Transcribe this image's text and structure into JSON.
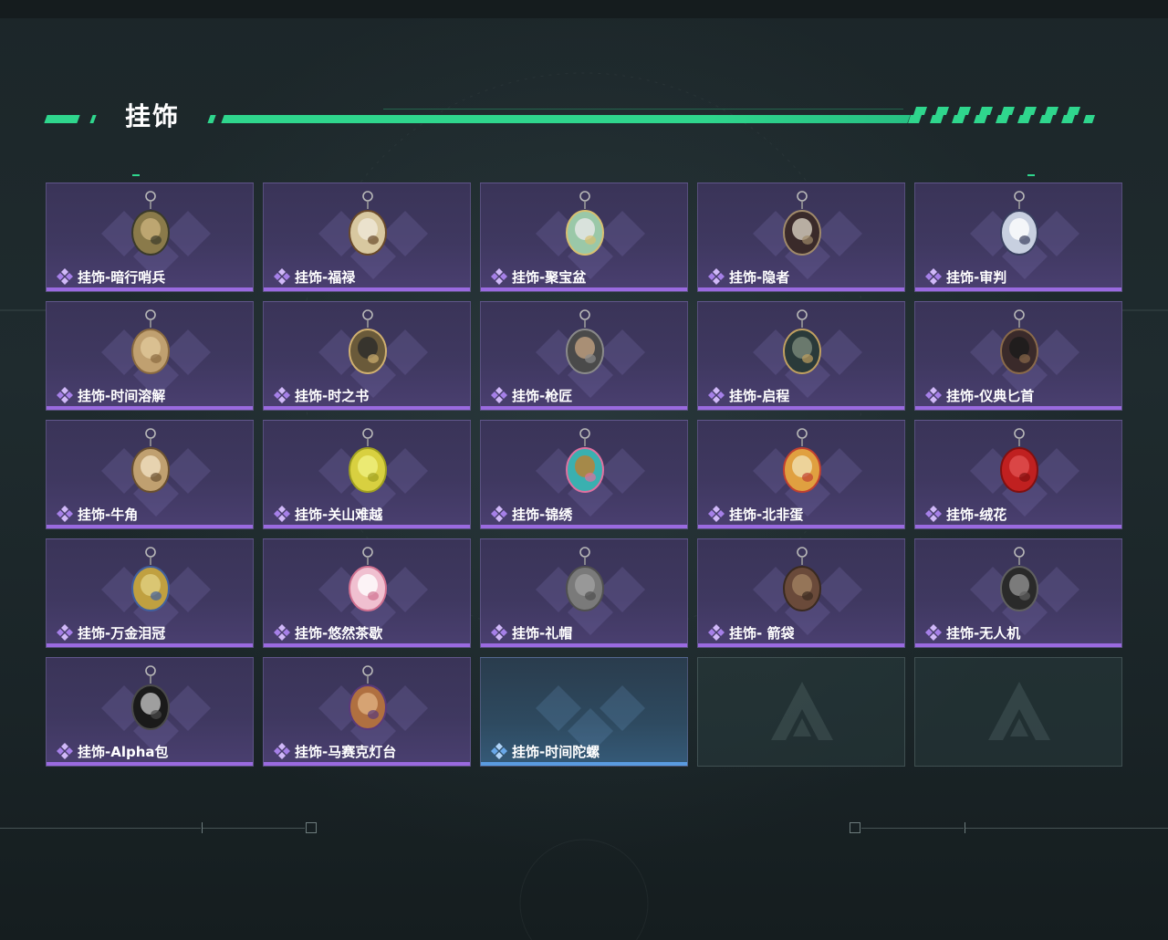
{
  "header": {
    "title": "挂饰"
  },
  "items": [
    {
      "label": "挂饰-暗行哨兵",
      "icon": "sentinel-charm-icon",
      "rarity": "purple"
    },
    {
      "label": "挂饰-福禄",
      "icon": "gourd-charm-icon",
      "rarity": "purple"
    },
    {
      "label": "挂饰-聚宝盆",
      "icon": "treasure-bowl-charm-icon",
      "rarity": "purple"
    },
    {
      "label": "挂饰-隐者",
      "icon": "hermit-card-charm-icon",
      "rarity": "purple"
    },
    {
      "label": "挂饰-审判",
      "icon": "judgement-card-charm-icon",
      "rarity": "purple"
    },
    {
      "label": "挂饰-时间溶解",
      "icon": "melting-clock-charm-icon",
      "rarity": "purple"
    },
    {
      "label": "挂饰-时之书",
      "icon": "time-book-charm-icon",
      "rarity": "purple"
    },
    {
      "label": "挂饰-枪匠",
      "icon": "gunsmith-charm-icon",
      "rarity": "purple"
    },
    {
      "label": "挂饰-启程",
      "icon": "departure-medal-charm-icon",
      "rarity": "purple"
    },
    {
      "label": "挂饰-仪典匕首",
      "icon": "ritual-dagger-charm-icon",
      "rarity": "purple"
    },
    {
      "label": "挂饰-牛角",
      "icon": "bull-horn-charm-icon",
      "rarity": "purple"
    },
    {
      "label": "挂饰-关山难越",
      "icon": "yellow-tube-charm-icon",
      "rarity": "purple"
    },
    {
      "label": "挂饰-锦绣",
      "icon": "butterfly-charm-icon",
      "rarity": "purple"
    },
    {
      "label": "挂饰-北非蛋",
      "icon": "shakshuka-charm-icon",
      "rarity": "purple"
    },
    {
      "label": "挂饰-绒花",
      "icon": "rose-charm-icon",
      "rarity": "purple"
    },
    {
      "label": "挂饰-万金泪冠",
      "icon": "crown-charm-icon",
      "rarity": "purple"
    },
    {
      "label": "挂饰-悠然茶歇",
      "icon": "cupcake-charm-icon",
      "rarity": "purple"
    },
    {
      "label": "挂饰-礼帽",
      "icon": "fedora-charm-icon",
      "rarity": "purple"
    },
    {
      "label": "挂饰- 箭袋",
      "icon": "quiver-charm-icon",
      "rarity": "purple"
    },
    {
      "label": "挂饰-无人机",
      "icon": "drone-charm-icon",
      "rarity": "purple"
    },
    {
      "label": "挂饰-Alpha包",
      "icon": "alpha-pack-charm-icon",
      "rarity": "purple"
    },
    {
      "label": "挂饰-马赛克灯台",
      "icon": "mosaic-lamp-charm-icon",
      "rarity": "purple"
    },
    {
      "label": "挂饰-时间陀螺",
      "icon": "",
      "rarity": "blue"
    },
    {
      "label": "",
      "icon": "empty-slot-logo-icon",
      "rarity": "empty"
    },
    {
      "label": "",
      "icon": "empty-slot-logo-icon",
      "rarity": "empty"
    }
  ],
  "colors": {
    "accent_green": "#2fd68d",
    "purple_rarity": "#9a6ae0",
    "blue_rarity": "#5a9be0"
  }
}
